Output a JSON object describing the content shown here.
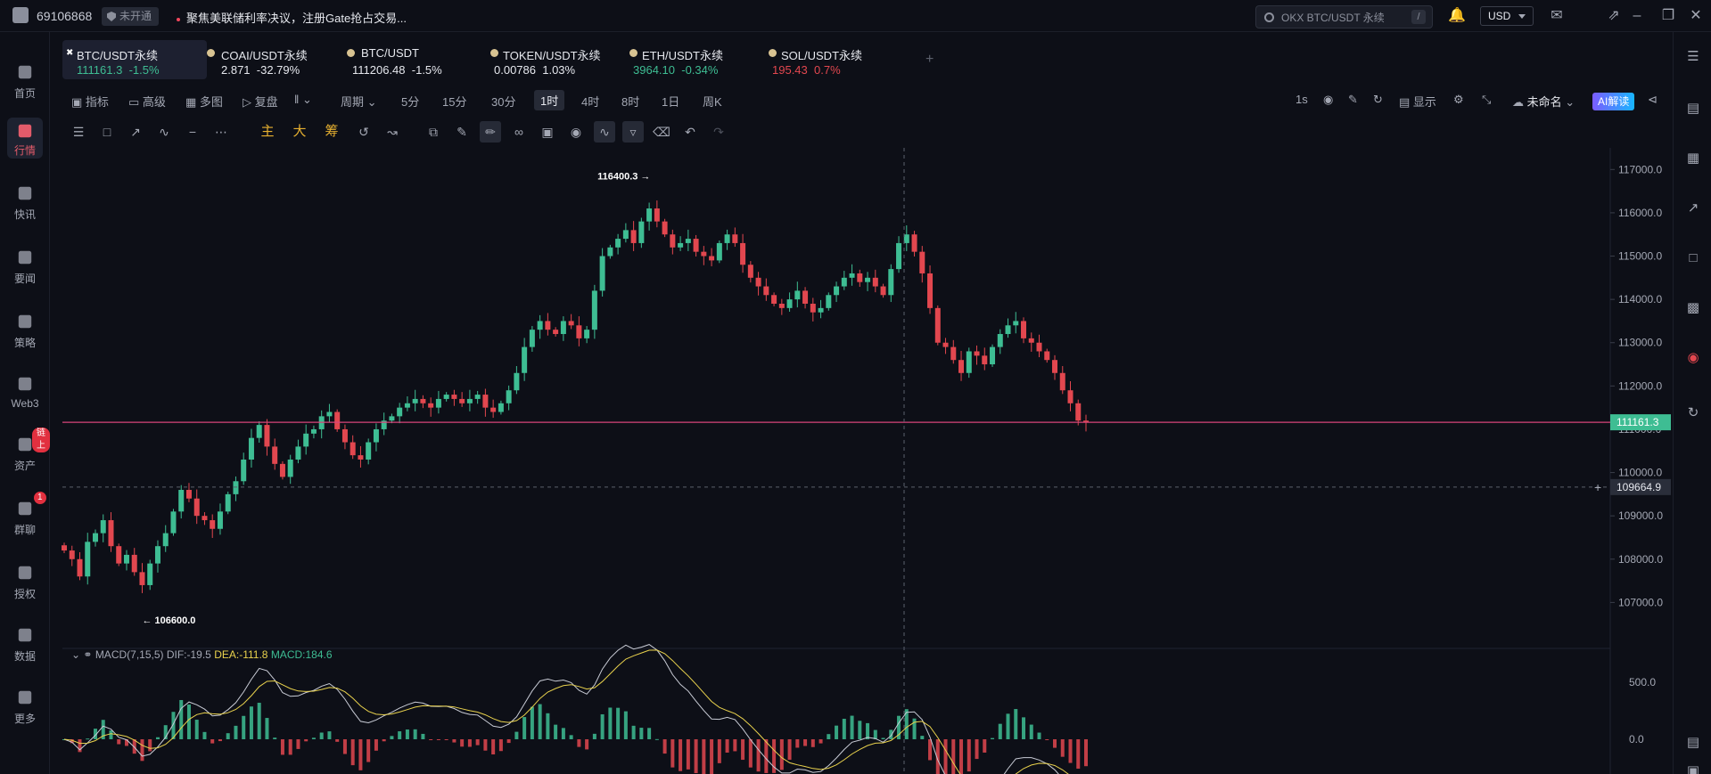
{
  "topbar": {
    "uid": "69106868",
    "badge": "未开通",
    "notice": "聚焦美联储利率决议，注册Gate抢占交易...",
    "search_placeholder": "OKX BTC/USDT 永续",
    "search_shortcut": "/",
    "currency": "USD"
  },
  "nav": [
    {
      "label": "首页",
      "icon": "home-icon"
    },
    {
      "label": "行情",
      "icon": "market-icon",
      "active": true
    },
    {
      "label": "快讯",
      "icon": "flash-news-icon"
    },
    {
      "label": "要闻",
      "icon": "news-icon"
    },
    {
      "label": "策略",
      "icon": "bot-icon"
    },
    {
      "label": "Web3",
      "icon": "web3-icon"
    },
    {
      "label": "资产",
      "icon": "wallet-icon",
      "badge": "链上"
    },
    {
      "label": "群聊",
      "icon": "chat-icon",
      "badge": "1"
    },
    {
      "label": "授权",
      "icon": "auth-icon"
    },
    {
      "label": "数据",
      "icon": "data-icon"
    },
    {
      "label": "更多",
      "icon": "more-icon"
    }
  ],
  "tabs": [
    {
      "name": "BTC/USDT永续",
      "price": "111161.3",
      "change": "-1.5%",
      "price_color": "green",
      "change_color": "green"
    },
    {
      "name": "COAI/USDT永续",
      "price": "2.871",
      "change": "-32.79%",
      "price_color": "white",
      "change_color": "white"
    },
    {
      "name": "BTC/USDT",
      "price": "111206.48",
      "change": "-1.5%",
      "price_color": "white",
      "change_color": "white"
    },
    {
      "name": "TOKEN/USDT永续",
      "price": "0.00786",
      "change": "1.03%",
      "price_color": "white",
      "change_color": "white"
    },
    {
      "name": "ETH/USDT永续",
      "price": "3964.10",
      "change": "-0.34%",
      "price_color": "green",
      "change_color": "green"
    },
    {
      "name": "SOL/USDT永续",
      "price": "195.43",
      "change": "0.7%",
      "price_color": "red",
      "change_color": "red"
    }
  ],
  "toolbar": {
    "indicators": "指标",
    "advanced": "高级",
    "multi": "多图",
    "replay": "复盘",
    "period": "周期",
    "intervals": [
      "5分",
      "15分",
      "30分",
      "1时",
      "4时",
      "8时",
      "1日",
      "周K"
    ],
    "selected_interval": "1时",
    "refresh": "1s",
    "display": "显示",
    "layout_name": "未命名",
    "ai": "AI解读"
  },
  "drawing_tools": {
    "main": "主",
    "big": "大",
    "chip": "筹"
  },
  "chart_data": {
    "type": "candlestick",
    "symbol": "BTC/USDT永续",
    "interval": "1时",
    "ylim": [
      106000,
      117500
    ],
    "y_ticks": [
      "117000.0",
      "116000.0",
      "115000.0",
      "114000.0",
      "113000.0",
      "112000.0",
      "111000.0",
      "110000.0",
      "109000.0",
      "108000.0",
      "107000.0"
    ],
    "high_label": "116400.3",
    "low_label": "106600.0",
    "last_price": "111161.3",
    "crosshair_price": "109664.9",
    "last_price_color": "#3ebd93",
    "up_color": "#3ebd93",
    "down_color": "#e2474f",
    "close_series": [
      108200,
      108000,
      107600,
      108400,
      108600,
      108900,
      108300,
      107900,
      108100,
      107700,
      107400,
      107900,
      108300,
      108600,
      109100,
      109600,
      109400,
      109000,
      108900,
      108700,
      109100,
      109500,
      109800,
      110300,
      110800,
      111100,
      110600,
      110200,
      109900,
      110300,
      110600,
      110900,
      111000,
      111300,
      111400,
      111000,
      110700,
      110400,
      110300,
      110700,
      111000,
      111200,
      111300,
      111500,
      111600,
      111700,
      111600,
      111500,
      111700,
      111800,
      111700,
      111600,
      111700,
      111800,
      111500,
      111400,
      111600,
      111900,
      112300,
      112900,
      113300,
      113500,
      113300,
      113200,
      113500,
      113400,
      113100,
      113300,
      114200,
      115000,
      115200,
      115400,
      115600,
      115300,
      115800,
      116100,
      115800,
      115500,
      115200,
      115300,
      115400,
      115100,
      115000,
      114900,
      115300,
      115500,
      115300,
      114800,
      114500,
      114300,
      114100,
      113900,
      113800,
      114000,
      114200,
      113900,
      113700,
      113800,
      114100,
      114300,
      114500,
      114600,
      114400,
      114500,
      114300,
      114100,
      114700,
      115300,
      115500,
      115100,
      114600,
      113800,
      113000,
      112900,
      112600,
      112300,
      112800,
      112700,
      112500,
      112900,
      113200,
      113400,
      113500,
      113100,
      113000,
      112800,
      112600,
      112300,
      111900,
      111600,
      111200,
      111161
    ]
  },
  "macd": {
    "label": "MACD(7,15,5)",
    "dif": "DIF:-19.5",
    "dea": "DEA:-111.8",
    "macd": "MACD:184.6",
    "y_ticks": [
      "500.0",
      "0.0"
    ]
  }
}
